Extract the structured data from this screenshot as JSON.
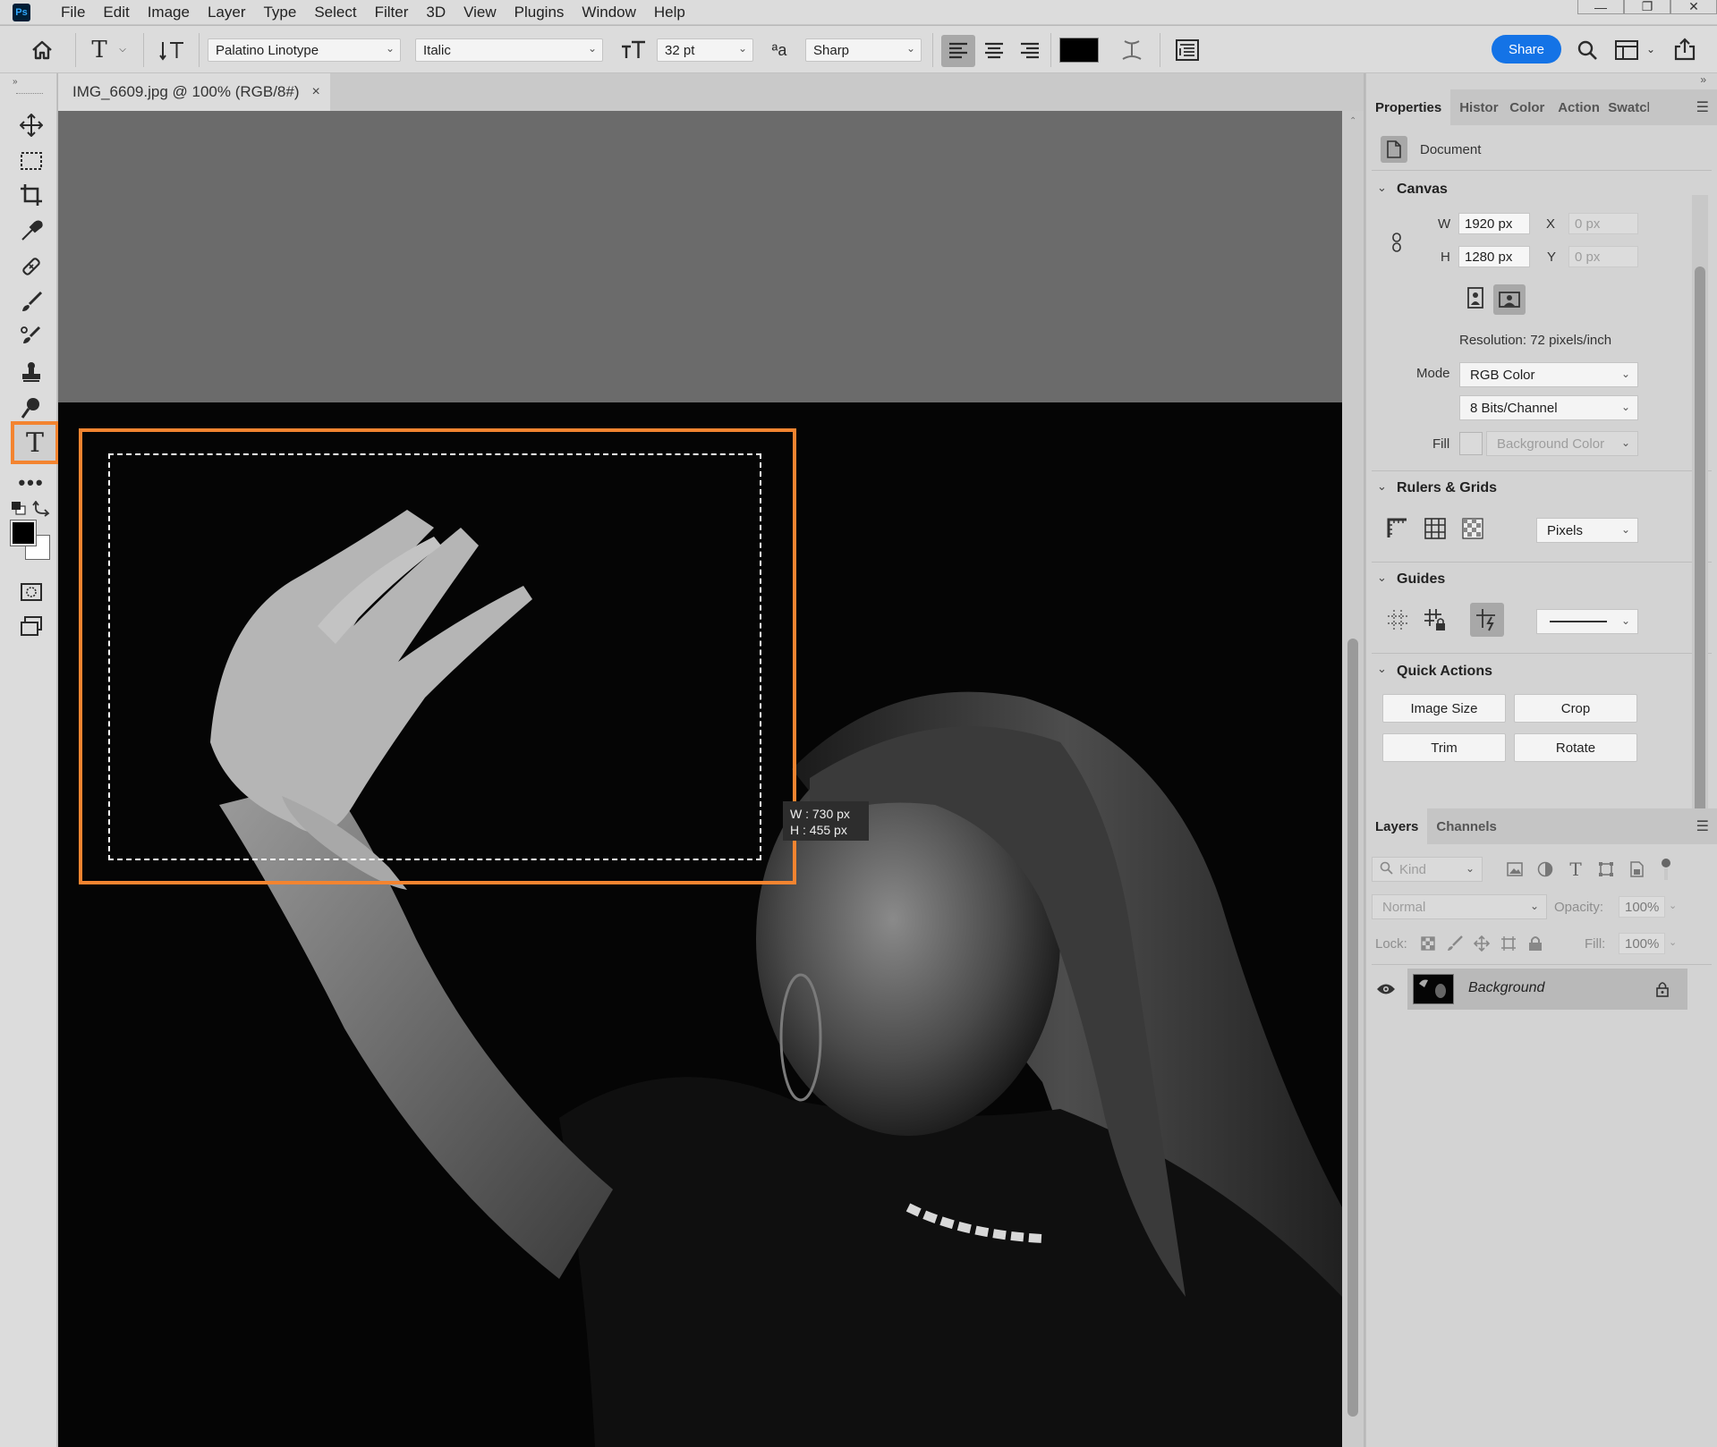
{
  "menubar": {
    "logo": "Ps",
    "items": [
      "File",
      "Edit",
      "Image",
      "Layer",
      "Type",
      "Select",
      "Filter",
      "3D",
      "View",
      "Plugins",
      "Window",
      "Help"
    ],
    "window_buttons": [
      "minimize-icon",
      "restore-icon",
      "close-icon"
    ]
  },
  "options": {
    "font_family": "Palatino Linotype",
    "font_style": "Italic",
    "font_size": "32 pt",
    "antialias_glyph": "ªa",
    "antialias": "Sharp",
    "color": "#000000",
    "share_label": "Share"
  },
  "document": {
    "tab_title": "IMG_6609.jpg @ 100% (RGB/8#)",
    "close": "×",
    "tooltip_w": "W :  730 px",
    "tooltip_h": "H :  455 px"
  },
  "properties": {
    "tabs": [
      "Properties",
      "Histor",
      "Color",
      "Action",
      "Swatcl"
    ],
    "doc_label": "Document",
    "canvas_title": "Canvas",
    "w_label": "W",
    "w_value": "1920 px",
    "h_label": "H",
    "h_value": "1280 px",
    "x_label": "X",
    "x_value": "0 px",
    "y_label": "Y",
    "y_value": "0 px",
    "resolution": "Resolution: 72 pixels/inch",
    "mode_label": "Mode",
    "mode_value": "RGB Color",
    "bits_value": "8 Bits/Channel",
    "fill_label": "Fill",
    "fill_value": "Background Color",
    "rulers_title": "Rulers & Grids",
    "units_value": "Pixels",
    "guides_title": "Guides",
    "quick_title": "Quick Actions",
    "quick_buttons": [
      "Image Size",
      "Crop",
      "Trim",
      "Rotate"
    ]
  },
  "layers": {
    "tabs": [
      "Layers",
      "Channels"
    ],
    "kind_placeholder": "Kind",
    "blend_mode": "Normal",
    "opacity_label": "Opacity:",
    "opacity_value": "100%",
    "lock_label": "Lock:",
    "fill_label": "Fill:",
    "fill_value": "100%",
    "layer_name": "Background"
  },
  "colors": {
    "accent": "#1473e6",
    "highlight": "#f38430",
    "foreground": "#000000",
    "background": "#ffffff"
  }
}
